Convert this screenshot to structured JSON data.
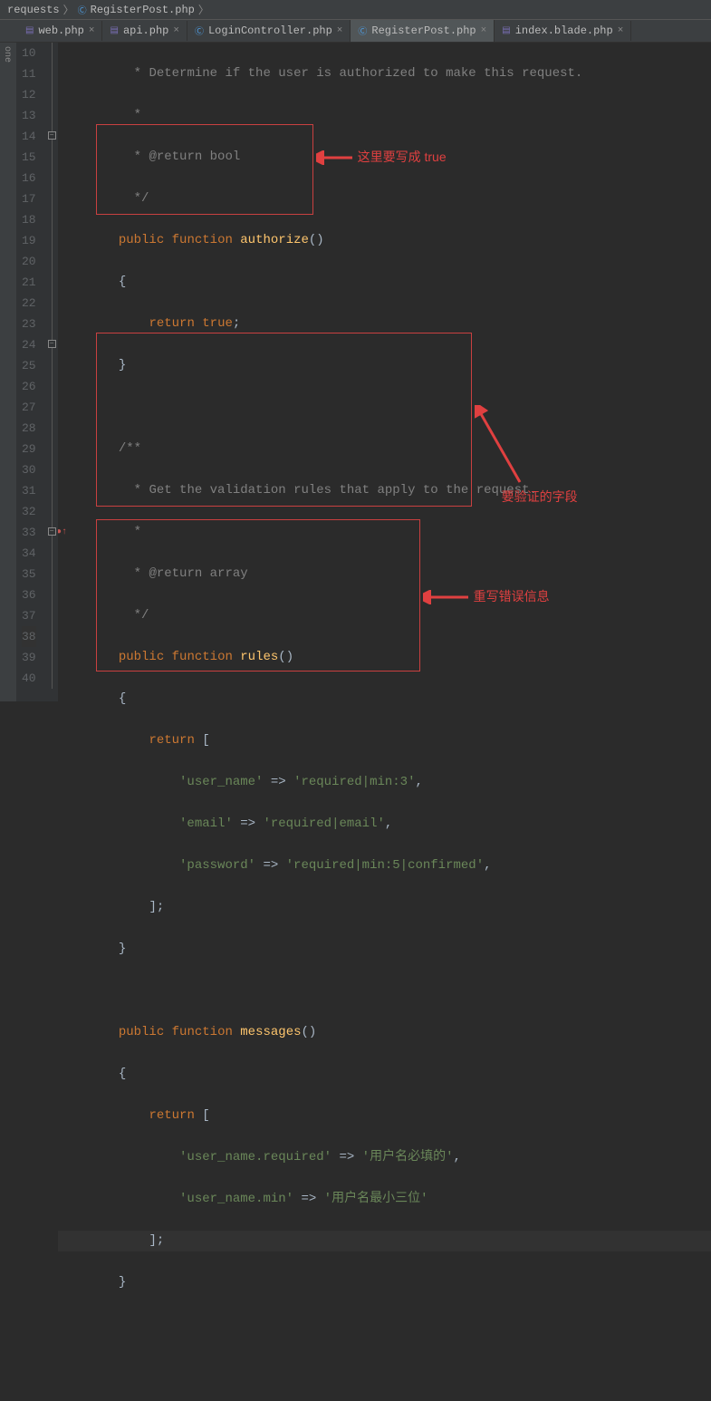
{
  "breadcrumb": {
    "item1": "requests",
    "item2": "RegisterPost.php"
  },
  "tabs": [
    {
      "label": "web.php",
      "icon": "php",
      "active": false
    },
    {
      "label": "api.php",
      "icon": "php",
      "active": false
    },
    {
      "label": "LoginController.php",
      "icon": "ctrl",
      "active": false
    },
    {
      "label": "RegisterPost.php",
      "icon": "ctrl",
      "active": true
    },
    {
      "label": "index.blade.php",
      "icon": "php",
      "active": false
    }
  ],
  "lines": {
    "start": 10,
    "end": 40
  },
  "code": {
    "l10": " * Determine if the user is authorized to make this request.",
    "l11": " *",
    "l12": " * @return bool",
    "l13": " */",
    "l14_kw1": "public",
    "l14_kw2": "function",
    "l14_fn": "authorize",
    "l14_end": "()",
    "l15": "{",
    "l16_kw": "return",
    "l16_val": "true",
    "l16_end": ";",
    "l17": "}",
    "l19": "/**",
    "l20": " * Get the validation rules that apply to the request.",
    "l21": " *",
    "l22": " * @return array",
    "l23": " */",
    "l24_kw1": "public",
    "l24_kw2": "function",
    "l24_fn": "rules",
    "l24_end": "()",
    "l25": "{",
    "l26_kw": "return",
    "l26_end": " [",
    "l27_k": "'user_name'",
    "l27_v": "'required|min:3'",
    "l28_k": "'email'",
    "l28_v": "'required|email'",
    "l29_k": "'password'",
    "l29_v": "'required|min:5|confirmed'",
    "l30": "];",
    "l31": "}",
    "l33_kw1": "public",
    "l33_kw2": "function",
    "l33_fn": "messages",
    "l33_end": "()",
    "l34": "{",
    "l35_kw": "return",
    "l35_end": " [",
    "l36_k": "'user_name.required'",
    "l36_v": "'用户名必填的'",
    "l37_k": "'user_name.min'",
    "l37_v": "'用户名最小三位'",
    "l38": "];",
    "l39": "}"
  },
  "annotations": {
    "a1": "这里要写成 true",
    "a2": "要验证的字段",
    "a3": "重写错误信息"
  },
  "side": "one"
}
